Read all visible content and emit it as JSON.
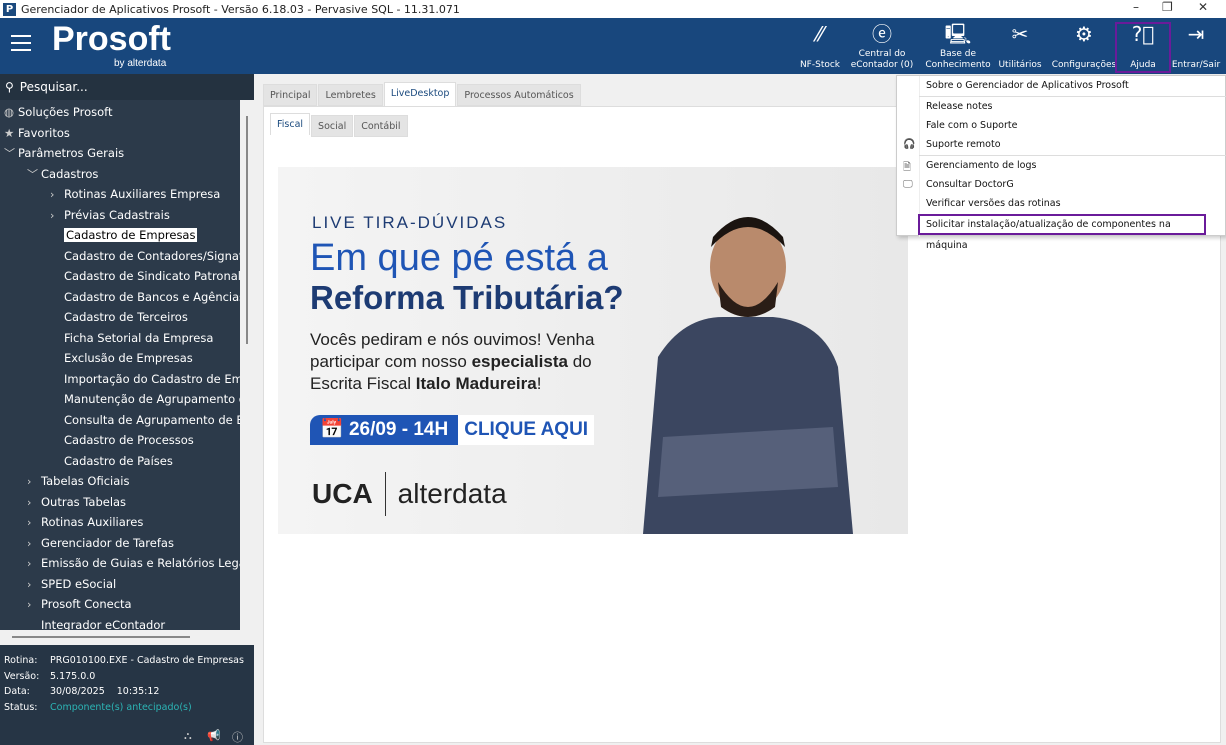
{
  "window": {
    "title": "Gerenciador de Aplicativos Prosoft - Versão 6.18.03 - Pervasive SQL - 11.31.071"
  },
  "header": {
    "logo_main": "Prosoft",
    "logo_sub": "by alterdata",
    "buttons": [
      {
        "label": "NF-Stock",
        "icon": "nfstock-icon"
      },
      {
        "label": "Central do eContador (0)",
        "icon": "econtador-icon"
      },
      {
        "label": "Base de Conhecimento",
        "icon": "knowledge-base-icon"
      },
      {
        "label": "Utilitários",
        "icon": "tools-icon"
      },
      {
        "label": "Configurações",
        "icon": "gear-icon"
      },
      {
        "label": "Ajuda",
        "icon": "help-icon"
      },
      {
        "label": "Entrar/Sair",
        "icon": "login-icon"
      }
    ]
  },
  "sidebar": {
    "search_placeholder": "Pesquisar...",
    "items": [
      {
        "label": "Soluções Prosoft",
        "level": 0,
        "icon": "globe"
      },
      {
        "label": "Favoritos",
        "level": 0,
        "icon": "star"
      },
      {
        "label": "Parâmetros Gerais",
        "level": 0,
        "icon": "expanded"
      },
      {
        "label": "Cadastros",
        "level": 1,
        "icon": "expanded"
      },
      {
        "label": "Rotinas Auxiliares Empresa",
        "level": 2,
        "icon": "collapsed"
      },
      {
        "label": "Prévias Cadastrais",
        "level": 2,
        "icon": "collapsed"
      },
      {
        "label": "Cadastro de Empresas",
        "level": 2,
        "icon": "leaf",
        "selected": true
      },
      {
        "label": "Cadastro de Contadores/Signatários",
        "level": 2,
        "icon": "leaf"
      },
      {
        "label": "Cadastro de Sindicato Patronal",
        "level": 2,
        "icon": "leaf"
      },
      {
        "label": "Cadastro de Bancos e Agências",
        "level": 2,
        "icon": "leaf"
      },
      {
        "label": "Cadastro de Terceiros",
        "level": 2,
        "icon": "leaf"
      },
      {
        "label": "Ficha Setorial da Empresa",
        "level": 2,
        "icon": "leaf"
      },
      {
        "label": "Exclusão de Empresas",
        "level": 2,
        "icon": "leaf"
      },
      {
        "label": "Importação do Cadastro de Empresas",
        "level": 2,
        "icon": "leaf"
      },
      {
        "label": "Manutenção de Agrupamento de Empresas",
        "level": 2,
        "icon": "leaf"
      },
      {
        "label": "Consulta de Agrupamento de Empresas",
        "level": 2,
        "icon": "leaf"
      },
      {
        "label": "Cadastro de Processos",
        "level": 2,
        "icon": "leaf"
      },
      {
        "label": "Cadastro de Países",
        "level": 2,
        "icon": "leaf"
      },
      {
        "label": "Tabelas Oficiais",
        "level": 1,
        "icon": "collapsed"
      },
      {
        "label": "Outras Tabelas",
        "level": 1,
        "icon": "collapsed"
      },
      {
        "label": "Rotinas Auxiliares",
        "level": 1,
        "icon": "collapsed"
      },
      {
        "label": "Gerenciador de Tarefas",
        "level": 1,
        "icon": "collapsed"
      },
      {
        "label": "Emissão de Guias e Relatórios Legais",
        "level": 1,
        "icon": "collapsed"
      },
      {
        "label": "SPED eSocial",
        "level": 1,
        "icon": "collapsed"
      },
      {
        "label": "Prosoft Conecta",
        "level": 1,
        "icon": "collapsed"
      },
      {
        "label": "Integrador eContador",
        "level": 1,
        "icon": "leaf"
      }
    ],
    "info": {
      "rotina_label": "Rotina:",
      "rotina": "PRG010100.EXE - Cadastro de Empresas",
      "versao_label": "Versão:",
      "versao": "5.175.0.0",
      "data_label": "Data:",
      "data": "30/08/2025",
      "hora": "10:35:12",
      "status_label": "Status:",
      "status": "Componente(s) antecipado(s)"
    }
  },
  "main": {
    "tabs": [
      "Principal",
      "Lembretes",
      "LiveDesktop",
      "Processos Automáticos"
    ],
    "active_tab": 2,
    "subtabs": [
      "Fiscal",
      "Social",
      "Contábil"
    ],
    "active_subtab": 0,
    "banner": {
      "kicker": "LIVE TIRA-DÚVIDAS",
      "title1": "Em que pé está a",
      "title2": "Reforma Tributária?",
      "body1": "Vocês pediram e nós ouvimos! Venha participar com nosso ",
      "body_bold1": "especialista",
      "body2": " do Escrita Fiscal ",
      "body_bold2": "Italo Madureira",
      "body3": "!",
      "date": "26/09 - 14H",
      "cta": "CLIQUE AQUI",
      "logo1": "UCA",
      "logo2": "alterdata"
    }
  },
  "help_menu": {
    "items": [
      {
        "label": "Sobre o Gerenciador de Aplicativos Prosoft",
        "icon": ""
      },
      {
        "label": "Release notes",
        "icon": ""
      },
      {
        "label": "Fale com o Suporte",
        "icon": ""
      },
      {
        "label": "Suporte remoto",
        "icon": "headset-icon"
      },
      {
        "label": "Gerenciamento de logs",
        "icon": "document-icon"
      },
      {
        "label": "Consultar DoctorG",
        "icon": "monitor-icon"
      },
      {
        "label": "Verificar versões das rotinas",
        "icon": ""
      },
      {
        "label": "Solicitar instalação/atualização de componentes na máquina",
        "icon": ""
      }
    ]
  }
}
